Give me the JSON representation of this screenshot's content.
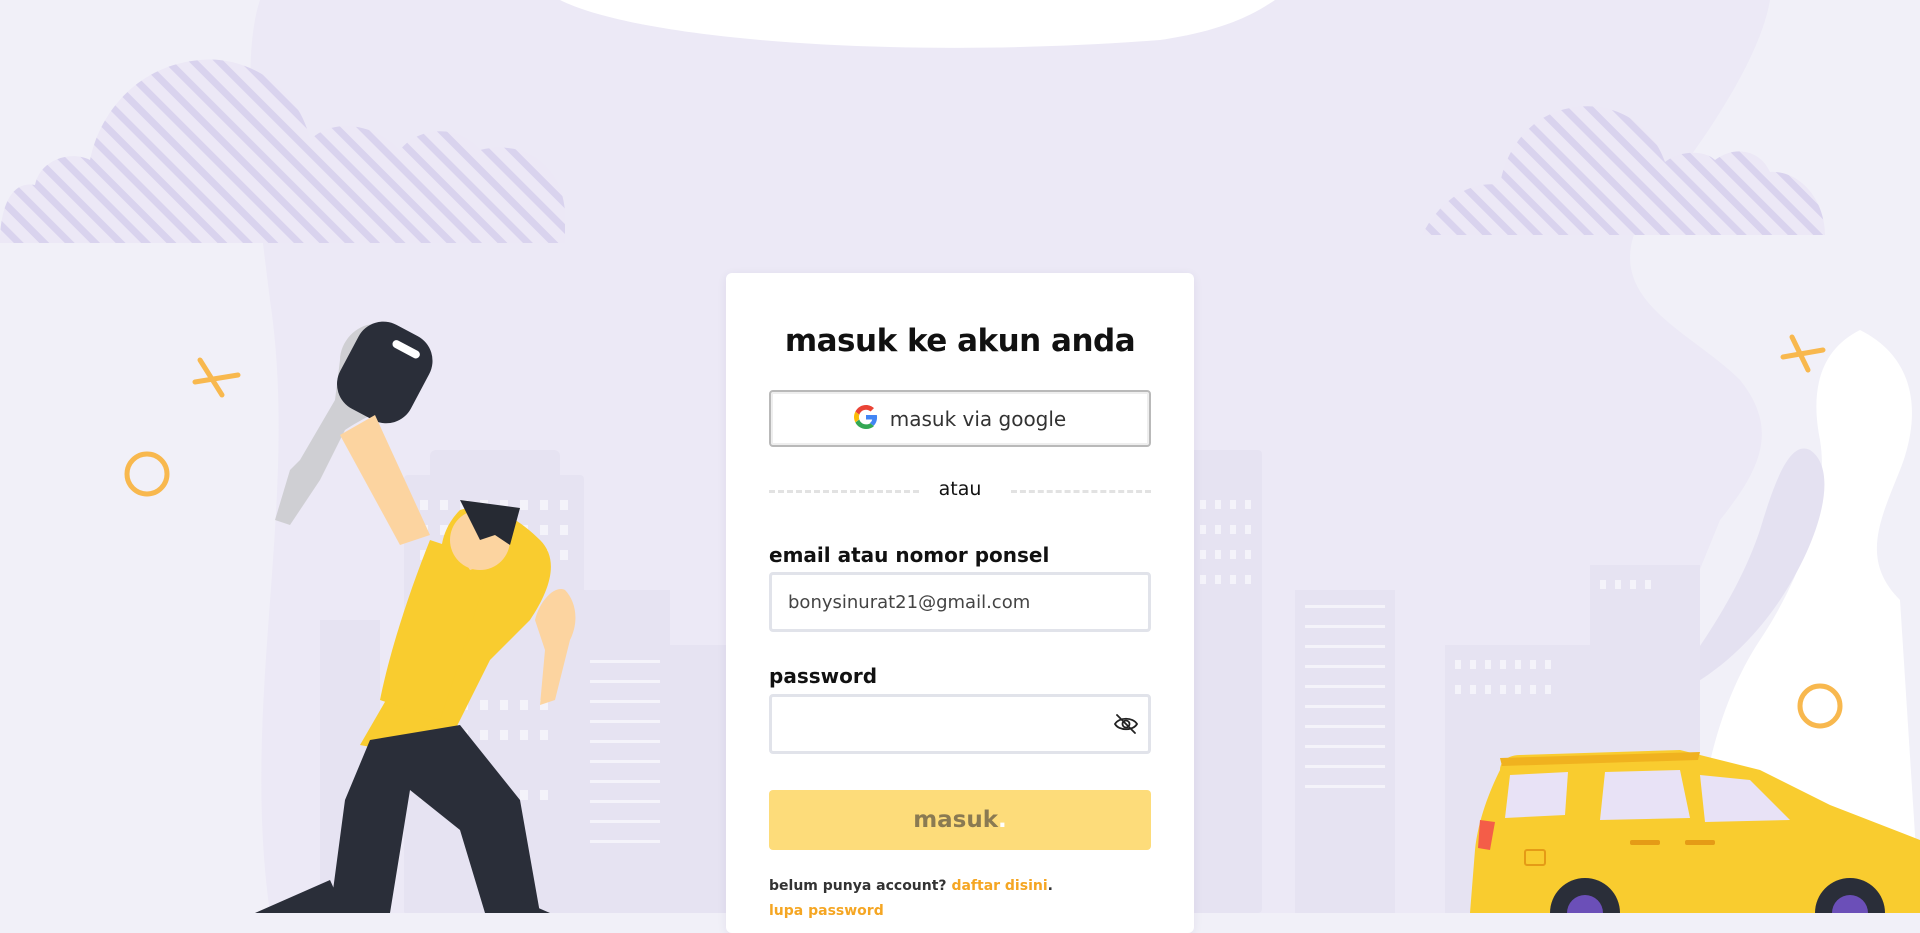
{
  "login": {
    "title": "masuk ke akun anda",
    "google_button": "masuk via google",
    "divider_text": "atau",
    "email_label": "email atau nomor ponsel",
    "email_value": "bonysinurat21@gmail.com",
    "password_label": "password",
    "password_value": "",
    "submit_label": "masuk",
    "submit_dot": ".",
    "signup_prompt": "belum punya account?",
    "signup_link": "daftar disini",
    "signup_period": ".",
    "forgot_link": "lupa password"
  },
  "icons": {
    "google": "google-logo-icon",
    "password_toggle": "eye-slash-icon"
  },
  "colors": {
    "page_bg": "#f1f0f8",
    "accent_yellow": "#f9cc2f",
    "button_disabled": "#fddc7a",
    "link_orange": "#f5a623",
    "cloud_purple": "#ddd8f0"
  }
}
